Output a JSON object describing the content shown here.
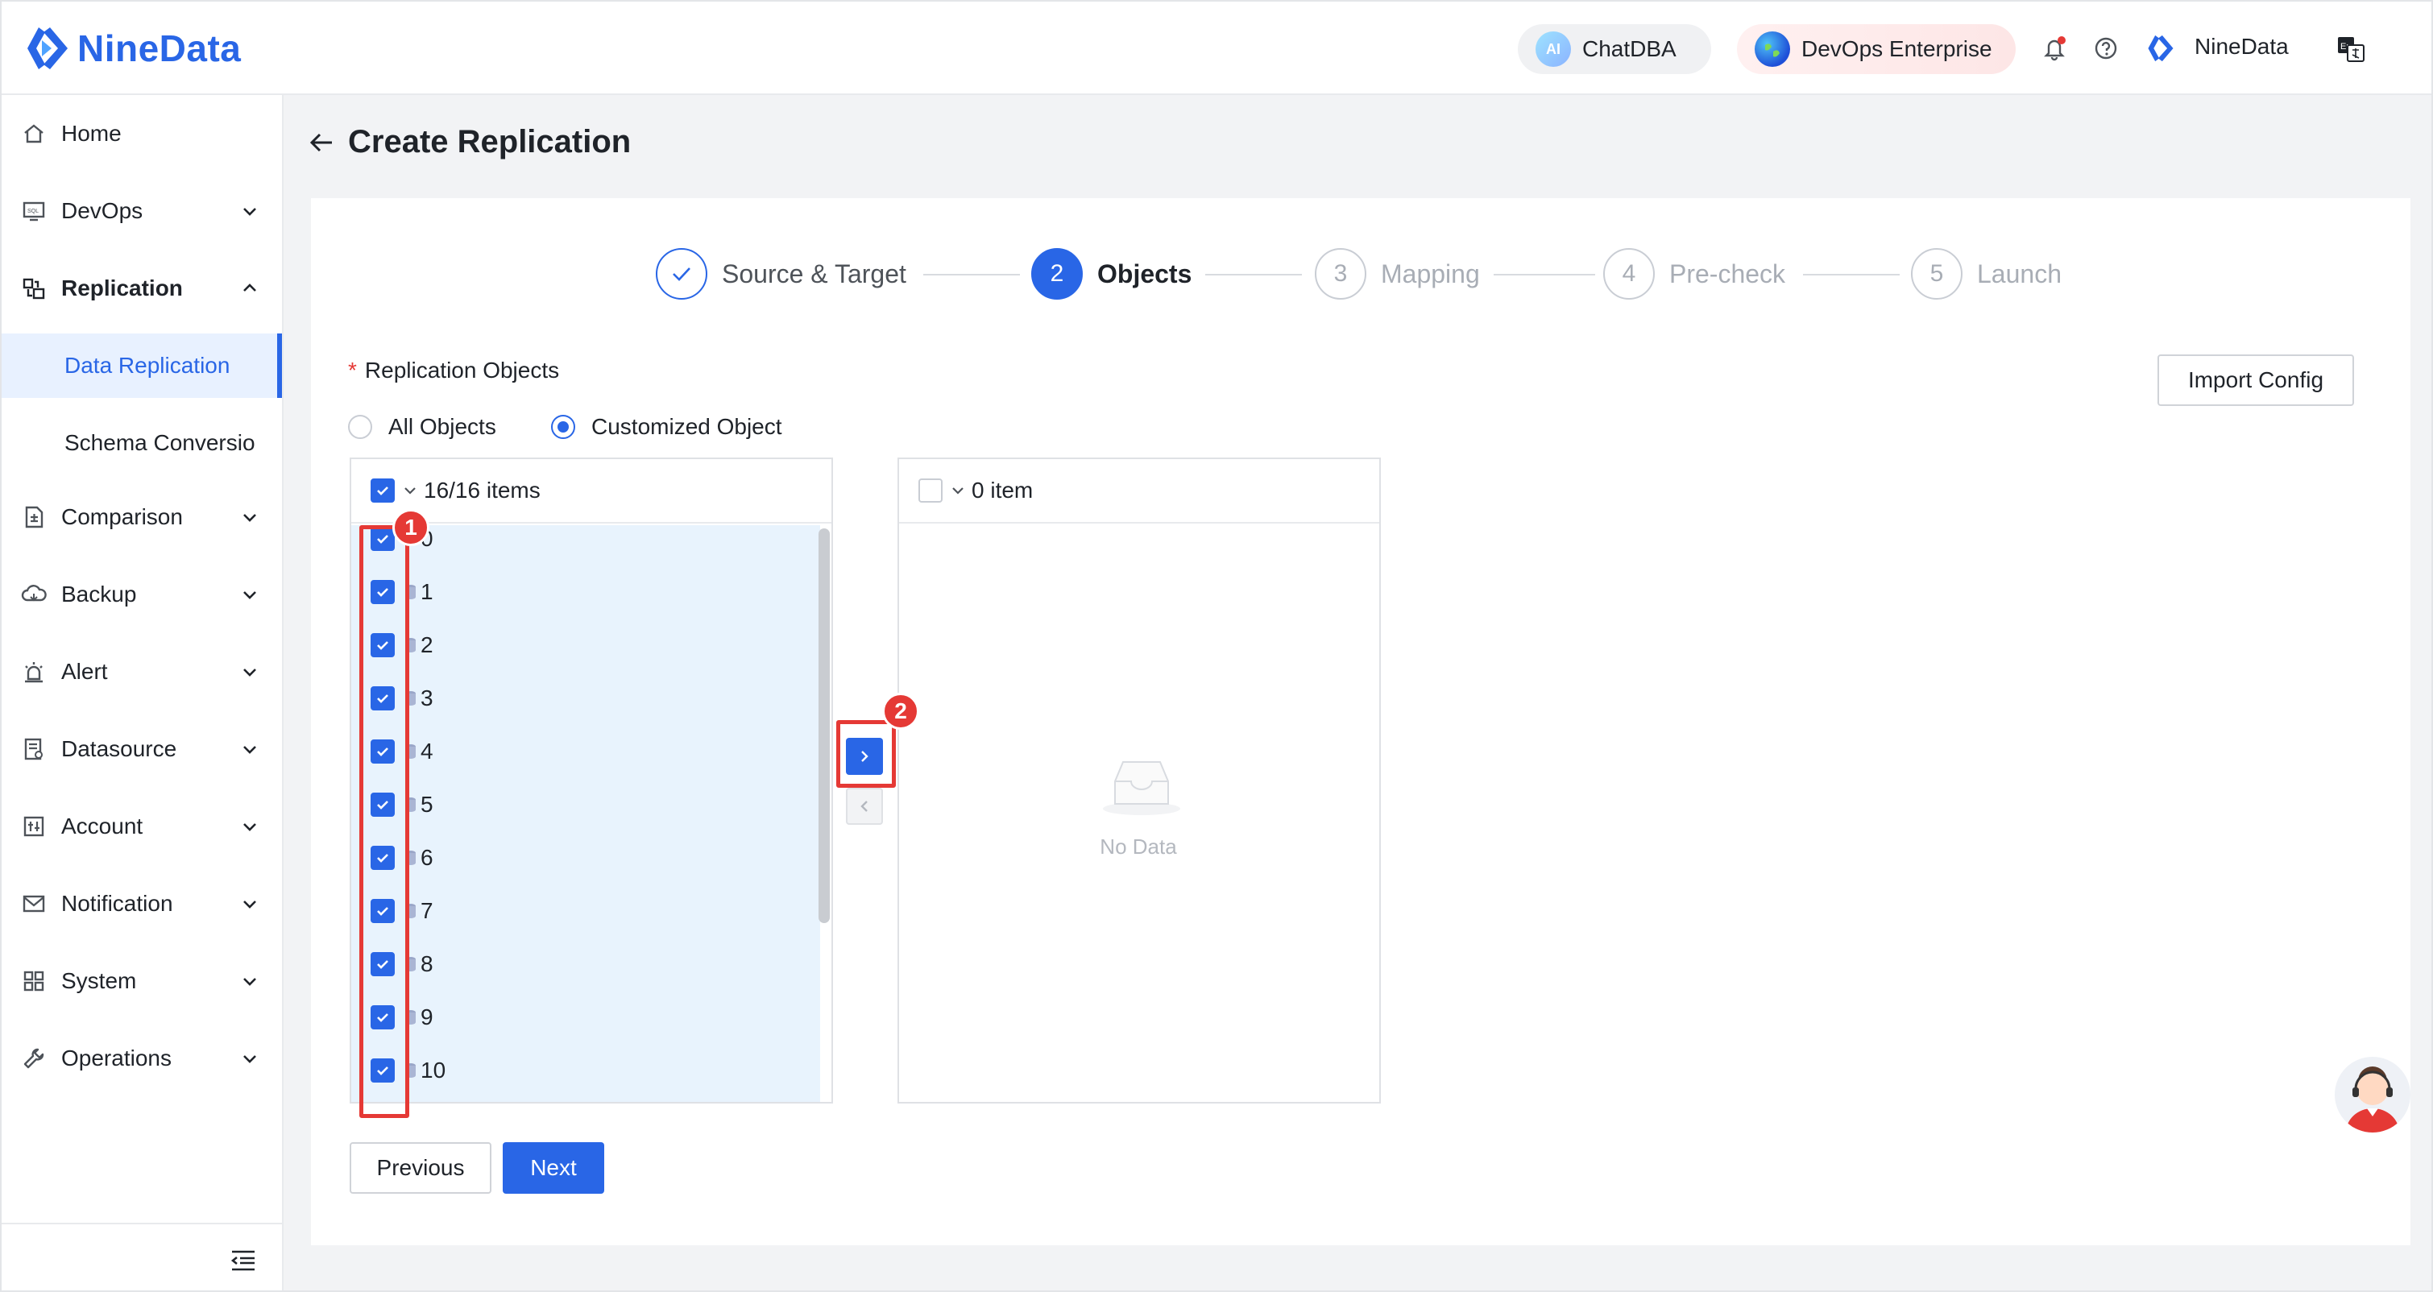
{
  "header": {
    "logo_text": "NineData",
    "chatdba_label": "ChatDBA",
    "ai_badge": "AI",
    "devops_label": "DevOps Enterprise",
    "user_name": "NineData"
  },
  "sidebar": {
    "items": [
      {
        "label": "Home",
        "icon": "home-icon"
      },
      {
        "label": "DevOps",
        "icon": "sql-icon"
      },
      {
        "label": "Replication",
        "icon": "replication-icon"
      },
      {
        "label": "Comparison",
        "icon": "comparison-icon"
      },
      {
        "label": "Backup",
        "icon": "cloud-backup-icon"
      },
      {
        "label": "Alert",
        "icon": "alarm-icon"
      },
      {
        "label": "Datasource",
        "icon": "datasource-icon"
      },
      {
        "label": "Account",
        "icon": "account-icon"
      },
      {
        "label": "Notification",
        "icon": "mail-icon"
      },
      {
        "label": "System",
        "icon": "grid-icon"
      },
      {
        "label": "Operations",
        "icon": "wrench-icon"
      }
    ],
    "sub_items": [
      {
        "label": "Data Replication",
        "active": true
      },
      {
        "label": "Schema Conversio",
        "active": false
      }
    ]
  },
  "page": {
    "title": "Create Replication"
  },
  "steps": [
    {
      "number": "",
      "label": "Source & Target",
      "state": "done"
    },
    {
      "number": "2",
      "label": "Objects",
      "state": "current"
    },
    {
      "number": "3",
      "label": "Mapping",
      "state": "pending"
    },
    {
      "number": "4",
      "label": "Pre-check",
      "state": "pending"
    },
    {
      "number": "5",
      "label": "Launch",
      "state": "pending"
    }
  ],
  "form": {
    "required_mark": "*",
    "objects_label": "Replication Objects",
    "import_button": "Import Config",
    "radio_all": "All Objects",
    "radio_custom": "Customized Object",
    "selected_option": "Customized Object"
  },
  "transfer": {
    "left_count": "16/16 items",
    "right_count": "0 item",
    "left_items": [
      "0",
      "1",
      "2",
      "3",
      "4",
      "5",
      "6",
      "7",
      "8",
      "9",
      "10"
    ],
    "empty_text": "No Data"
  },
  "annotations": {
    "badge_1": "1",
    "badge_2": "2"
  },
  "buttons": {
    "previous": "Previous",
    "next": "Next"
  },
  "colors": {
    "primary": "#2966e6",
    "annotation": "#e53935",
    "selected_row_bg": "#e8f3fd"
  }
}
